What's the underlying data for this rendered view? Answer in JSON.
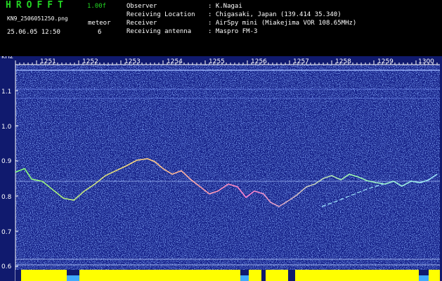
{
  "header": {
    "app_title": "HROFFT",
    "version": "1.00f",
    "filename": "KN9_2506051250.png",
    "timestamp": "25.06.05 12:50",
    "meteor_label": "meteor",
    "meteor_count": "6"
  },
  "info": {
    "rows": [
      {
        "label": "Observer",
        "value": ": K.Nagai"
      },
      {
        "label": "Receiving Location",
        "value": ": Chigasaki, Japan (139.414 35.340)"
      },
      {
        "label": "Receiver",
        "value": ": AirSpy mini (Miakejima VOR 108.65MHz)"
      },
      {
        "label": "Receiving antenna",
        "value": ": Maspro FM-3"
      }
    ]
  },
  "spectrogram": {
    "y_unit": "kHz",
    "y_ticks": [
      "1.1",
      "1.0",
      "0.9",
      "0.8",
      "0.7",
      "0.6"
    ],
    "time_ticks": [
      "1251",
      "1252",
      "1253",
      "1254",
      "1255",
      "1256",
      "1257",
      "1258",
      "1259",
      "1300"
    ],
    "colors": {
      "background": "#101a6e",
      "axis": "#ffffff",
      "noise_floor": "#ffff00",
      "header_text": "#23d523"
    }
  }
}
